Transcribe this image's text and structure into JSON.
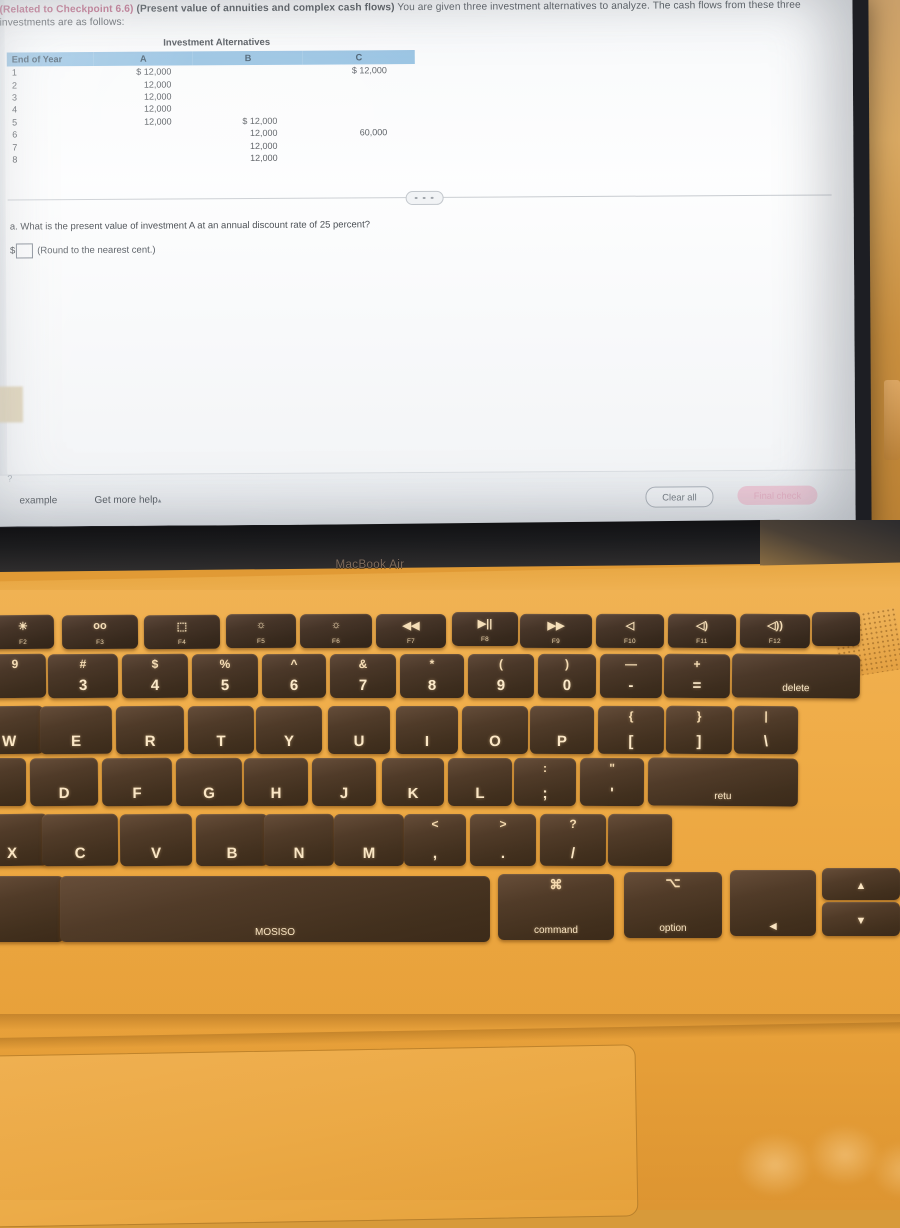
{
  "device": {
    "brand_label": "MacBook Air",
    "keyboard_brand_key": "MOSISO"
  },
  "problem": {
    "related_tag": "(Related to Checkpoint 6.6)",
    "topic": "(Present value of annuities and complex cash flows)",
    "prompt": "You are given three investment alternatives to analyze.  The cash flows from these three investments are as follows:",
    "table_title": "Investment Alternatives",
    "columns": [
      "End of Year",
      "A",
      "B",
      "C"
    ],
    "rows": [
      {
        "year": "1",
        "a": "$ 12,000",
        "b": "",
        "c": "$ 12,000"
      },
      {
        "year": "2",
        "a": "12,000",
        "b": "",
        "c": ""
      },
      {
        "year": "3",
        "a": "12,000",
        "b": "",
        "c": ""
      },
      {
        "year": "4",
        "a": "12,000",
        "b": "",
        "c": ""
      },
      {
        "year": "5",
        "a": "12,000",
        "b": "$ 12,000",
        "c": ""
      },
      {
        "year": "6",
        "a": "",
        "b": "12,000",
        "c": "60,000"
      },
      {
        "year": "7",
        "a": "",
        "b": "12,000",
        "c": ""
      },
      {
        "year": "8",
        "a": "",
        "b": "12,000",
        "c": ""
      }
    ],
    "part_a_label": "a.",
    "part_a_question": "What is the present value of investment A at an annual discount rate of 25 percent?",
    "answer_currency": "$",
    "answer_value": "",
    "answer_hint": "(Round to the nearest cent.)"
  },
  "toolbar": {
    "help_icon": "question-mark-icon",
    "example_label": "example",
    "get_more_help_label": "Get more help",
    "get_more_help_caret": "▴",
    "clear_all_label": "Clear all",
    "final_check_label": "Final check"
  },
  "colors": {
    "table_header_bg": "#7fb6de",
    "related_tag": "#b8436a",
    "final_check_bg": "#f7c3d3",
    "final_check_text": "#ec9fb8",
    "keyboard_backlight": "#f0b254"
  },
  "keyboard": {
    "function_row": [
      {
        "sup": "☀",
        "main": "F2"
      },
      {
        "sup": "oo",
        "main": "F3"
      },
      {
        "sup": "⬚",
        "main": "F4"
      },
      {
        "sup": "☼",
        "main": "F5"
      },
      {
        "sup": "☼",
        "main": "F6"
      },
      {
        "sup": "◀◀",
        "main": "F7"
      },
      {
        "sup": "▶||",
        "main": "F8"
      },
      {
        "sup": "▶▶",
        "main": "F9"
      },
      {
        "sup": "◁",
        "main": "F10"
      },
      {
        "sup": "◁)",
        "main": "F11"
      },
      {
        "sup": "◁))",
        "main": "F12"
      }
    ],
    "number_row": [
      {
        "sup": "#",
        "main": "3"
      },
      {
        "sup": "$",
        "main": "4"
      },
      {
        "sup": "%",
        "main": "5"
      },
      {
        "sup": "^",
        "main": "6"
      },
      {
        "sup": "&",
        "main": "7"
      },
      {
        "sup": "*",
        "main": "8"
      },
      {
        "sup": "(",
        "main": "9"
      },
      {
        "sup": ")",
        "main": "0"
      },
      {
        "sup": "—",
        "main": "-"
      },
      {
        "sup": "+",
        "main": "="
      },
      {
        "sup": "",
        "main": "delete"
      }
    ],
    "top_row": [
      {
        "sup": "",
        "main": "W"
      },
      {
        "sup": "",
        "main": "E"
      },
      {
        "sup": "",
        "main": "R"
      },
      {
        "sup": "",
        "main": "T"
      },
      {
        "sup": "",
        "main": "Y"
      },
      {
        "sup": "",
        "main": "U"
      },
      {
        "sup": "",
        "main": "I"
      },
      {
        "sup": "",
        "main": "O"
      },
      {
        "sup": "",
        "main": "P"
      },
      {
        "sup": "{",
        "main": "["
      },
      {
        "sup": "}",
        "main": "]"
      },
      {
        "sup": "|",
        "main": "\\"
      }
    ],
    "home_row": [
      {
        "sup": "",
        "main": "D"
      },
      {
        "sup": "",
        "main": "F"
      },
      {
        "sup": "",
        "main": "G"
      },
      {
        "sup": "",
        "main": "H"
      },
      {
        "sup": "",
        "main": "J"
      },
      {
        "sup": "",
        "main": "K"
      },
      {
        "sup": "",
        "main": "L"
      },
      {
        "sup": ":",
        "main": ";"
      },
      {
        "sup": "\"",
        "main": "'"
      },
      {
        "sup": "",
        "main": "return"
      }
    ],
    "bottom_row": [
      {
        "sup": "",
        "main": "X"
      },
      {
        "sup": "",
        "main": "C"
      },
      {
        "sup": "",
        "main": "V"
      },
      {
        "sup": "",
        "main": "B"
      },
      {
        "sup": "",
        "main": "N"
      },
      {
        "sup": "",
        "main": "M"
      },
      {
        "sup": "<",
        "main": ","
      },
      {
        "sup": ">",
        "main": "."
      },
      {
        "sup": "?",
        "main": "/"
      },
      {
        "sup": "",
        "main": ""
      }
    ],
    "modifier_row": [
      {
        "sup": "",
        "main": "MOSISO"
      },
      {
        "sup": "⌘",
        "main": "command"
      },
      {
        "sup": "⌥",
        "main": "option"
      },
      {
        "sup": "",
        "main": "◀"
      }
    ],
    "arrow_up": "▲",
    "arrow_down": "▼"
  }
}
